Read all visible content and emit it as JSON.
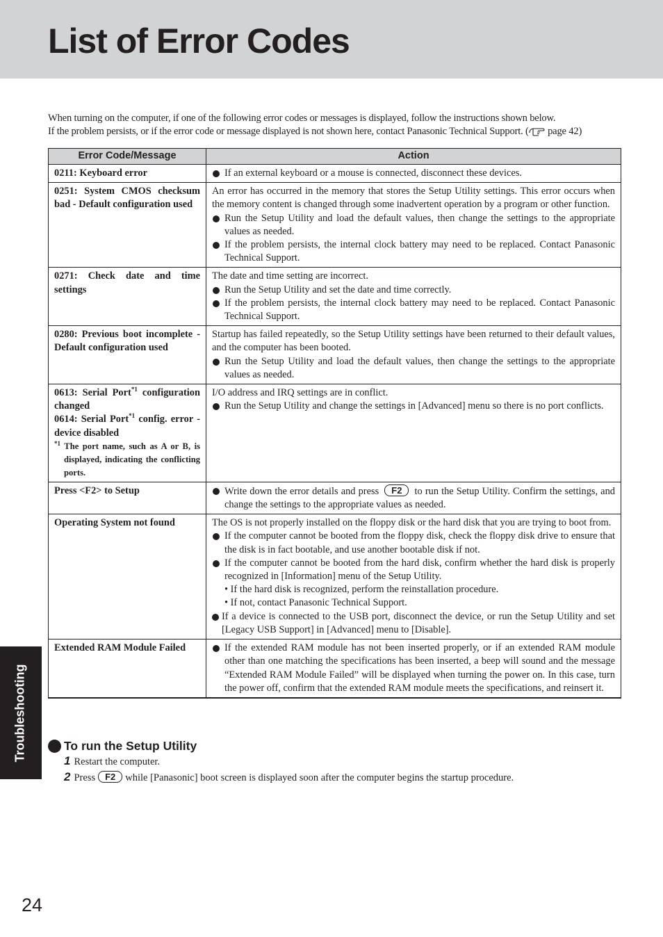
{
  "header": {
    "title": "List of Error Codes",
    "band_color": "#d1d3d4"
  },
  "intro": {
    "line1": "When turning on the computer, if one of the following error codes or messages is displayed, follow the instructions shown below.",
    "line2": "If the problem persists, or if the error code or message displayed is not shown here, contact Panasonic Technical Support. (",
    "ref_icon": "pointing-hand-icon",
    "ref_page": " page 42)"
  },
  "table": {
    "headers": [
      "Error Code/Message",
      "Action"
    ],
    "rows": [
      {
        "code": "0211: Keyboard error",
        "bullets": [
          "If an external keyboard or a mouse is connected, disconnect these devices."
        ]
      },
      {
        "code": "0251: System CMOS checksum bad - Default configuration used",
        "intro": "An error has occurred in the memory that stores the Setup Utility settings.  This error occurs when the memory content is changed through some inadvertent operation by a program or other function.",
        "bullets": [
          "Run the Setup Utility and load the default values, then change the settings to the appropriate values as needed.",
          "If the problem persists, the internal clock battery may need to be replaced. Contact Panasonic Technical Support."
        ]
      },
      {
        "code": "0271: Check date and time settings",
        "intro": "The date and time setting are incorrect.",
        "bullets": [
          "Run the Setup Utility and set the date and time correctly.",
          "If the problem persists, the internal clock battery may need to be replaced. Contact Panasonic Technical Support."
        ]
      },
      {
        "code": "0280: Previous boot incomplete - Default configuration used",
        "intro": "Startup has failed repeatedly, so the Setup Utility settings have been returned to their default values, and the computer has been booted.",
        "bullets": [
          "Run the Setup Utility and load the default values, then change the settings to the appropriate values as needed."
        ]
      },
      {
        "code_a": "0613: Serial Port",
        "code_a_rest": " configuration changed",
        "code_b": "0614: Serial Port",
        "code_b_rest": " config. error - device disabled",
        "footnote_mark": "*1",
        "footnote": "The port name, such as A or B, is displayed, indicating the conflicting ports.",
        "intro": "I/O address and IRQ settings are in conflict.",
        "bullets": [
          "Run the Setup Utility and change the settings in [Advanced] menu so there is no port conflicts."
        ]
      },
      {
        "code": "Press <F2> to Setup",
        "bullet_pre": "Write down the error details and press",
        "key": "F2",
        "bullet_post": "to run the Setup Utility. Confirm the settings, and change the settings to the appropriate values as needed."
      },
      {
        "code": "Operating System not found",
        "intro": "The OS is not properly installed on the floppy disk or the hard disk that you are trying to boot from.",
        "bullets": [
          "If the computer cannot be booted from the floppy disk, check the floppy disk drive to ensure that the disk is in fact bootable, and use another bootable disk if not.",
          "If the computer cannot be booted from the hard disk, confirm whether the hard disk is properly recognized in [Information] menu of the Setup Utility."
        ],
        "sub_items": [
          "• If the hard disk is recognized, perform the reinstallation procedure.",
          "• If not, contact Panasonic Technical Support."
        ],
        "last_bullet": "If a device is connected to the USB port, disconnect the device, or run the Setup Utility and set [Legacy USB Support] in [Advanced] menu to [Disable]."
      },
      {
        "code": "Extended RAM Module Failed",
        "bullets": [
          "If the extended RAM module has not been inserted properly, or if an extended RAM module other than one matching the specifications has been inserted, a beep will sound and the message “Extended RAM Module Failed” will be displayed when turning the power on. In this case, turn the power off, confirm that the extended RAM module meets the specifications, and reinsert it."
        ]
      }
    ]
  },
  "setup": {
    "title": "To run the Setup Utility",
    "steps": [
      {
        "num": "1",
        "text": "Restart the computer."
      },
      {
        "num": "2",
        "pre": "Press",
        "key": "F2",
        "post": "while [Panasonic] boot screen is displayed soon after the computer begins the startup procedure."
      }
    ]
  },
  "side_tab": {
    "label": "Troubleshooting"
  },
  "page_number": "24"
}
